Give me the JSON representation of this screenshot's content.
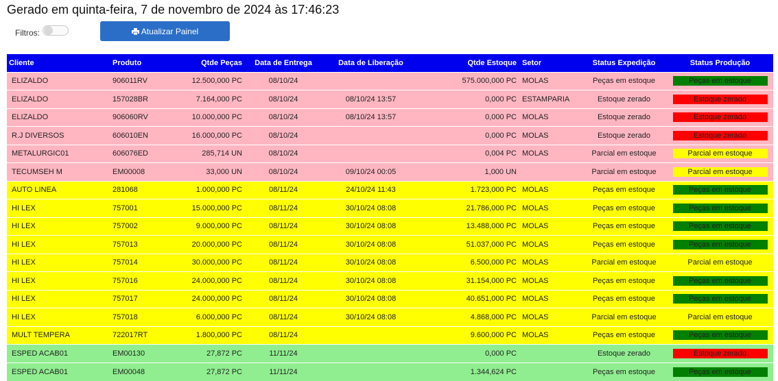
{
  "header": {
    "title": "Gerado em quinta-feira, 7 de novembro de 2024 às 17:46:23",
    "filters_label": "Filtros:",
    "refresh_label": "Atualizar Painel"
  },
  "table": {
    "columns": [
      "Cliente",
      "Produto",
      "Qtde Peças",
      "Data de Entrega",
      "Data de Liberação",
      "Qtde Estoque",
      "Setor",
      "Status Expedição",
      "Status Produção"
    ],
    "rows": [
      {
        "row_color": "#ffb6c1",
        "badge_color": "#008000",
        "cliente": "ELIZALDO",
        "produto": "906011RV",
        "qtde_pecas": "12.500,000 PC",
        "data_entrega": "08/10/24",
        "data_liberacao": "",
        "qtde_estoque": "575.000,000 PC",
        "setor": "MOLAS",
        "status_expedicao": "Peças em estoque",
        "status_producao": "Peças em estoque"
      },
      {
        "row_color": "#ffb6c1",
        "badge_color": "#ff0000",
        "cliente": "ELIZALDO",
        "produto": "157028BR",
        "qtde_pecas": "7.164,000 PC",
        "data_entrega": "08/10/24",
        "data_liberacao": "08/10/24 13:57",
        "qtde_estoque": "0,000 PC",
        "setor": "ESTAMPARIA",
        "status_expedicao": "Estoque zerado",
        "status_producao": "Estoque zerado"
      },
      {
        "row_color": "#ffb6c1",
        "badge_color": "#ff0000",
        "cliente": "ELIZALDO",
        "produto": "906060RV",
        "qtde_pecas": "10.000,000 PC",
        "data_entrega": "08/10/24",
        "data_liberacao": "08/10/24 13:57",
        "qtde_estoque": "0,000 PC",
        "setor": "MOLAS",
        "status_expedicao": "Estoque zerado",
        "status_producao": "Estoque zerado"
      },
      {
        "row_color": "#ffb6c1",
        "badge_color": "#ff0000",
        "cliente": "R.J DIVERSOS",
        "produto": "606010EN",
        "qtde_pecas": "16.000,000 PC",
        "data_entrega": "08/10/24",
        "data_liberacao": "",
        "qtde_estoque": "0,000 PC",
        "setor": "MOLAS",
        "status_expedicao": "Estoque zerado",
        "status_producao": "Estoque zerado"
      },
      {
        "row_color": "#ffb6c1",
        "badge_color": "#ffff00",
        "cliente": "METALURGIC01",
        "produto": "606076ED",
        "qtde_pecas": "285,714 UN",
        "data_entrega": "08/10/24",
        "data_liberacao": "",
        "qtde_estoque": "0,004 PC",
        "setor": "MOLAS",
        "status_expedicao": "Parcial em estoque",
        "status_producao": "Parcial em estoque"
      },
      {
        "row_color": "#ffb6c1",
        "badge_color": "#ffff00",
        "cliente": "TECUMSEH M",
        "produto": "EM00008",
        "qtde_pecas": "33,000 UN",
        "data_entrega": "08/10/24",
        "data_liberacao": "09/10/24 00:05",
        "qtde_estoque": "1,000 UN",
        "setor": "",
        "status_expedicao": "Parcial em estoque",
        "status_producao": "Parcial em estoque"
      },
      {
        "row_color": "#ffff00",
        "badge_color": "#008000",
        "cliente": "AUTO LINEA",
        "produto": "281068",
        "qtde_pecas": "1.000,000 PC",
        "data_entrega": "08/11/24",
        "data_liberacao": "24/10/24 11:43",
        "qtde_estoque": "1.723,000 PC",
        "setor": "MOLAS",
        "status_expedicao": "Peças em estoque",
        "status_producao": "Peças em estoque"
      },
      {
        "row_color": "#ffff00",
        "badge_color": "#008000",
        "cliente": "HI LEX",
        "produto": "757001",
        "qtde_pecas": "15.000,000 PC",
        "data_entrega": "08/11/24",
        "data_liberacao": "30/10/24 08:08",
        "qtde_estoque": "21.786,000 PC",
        "setor": "MOLAS",
        "status_expedicao": "Peças em estoque",
        "status_producao": "Peças em estoque"
      },
      {
        "row_color": "#ffff00",
        "badge_color": "#008000",
        "cliente": "HI LEX",
        "produto": "757002",
        "qtde_pecas": "9.000,000 PC",
        "data_entrega": "08/11/24",
        "data_liberacao": "30/10/24 08:08",
        "qtde_estoque": "13.488,000 PC",
        "setor": "MOLAS",
        "status_expedicao": "Peças em estoque",
        "status_producao": "Peças em estoque"
      },
      {
        "row_color": "#ffff00",
        "badge_color": "#008000",
        "cliente": "HI LEX",
        "produto": "757013",
        "qtde_pecas": "20.000,000 PC",
        "data_entrega": "08/11/24",
        "data_liberacao": "30/10/24 08:08",
        "qtde_estoque": "51.037,000 PC",
        "setor": "MOLAS",
        "status_expedicao": "Peças em estoque",
        "status_producao": "Peças em estoque"
      },
      {
        "row_color": "#ffff00",
        "badge_color": "#ffff00",
        "cliente": "HI LEX",
        "produto": "757014",
        "qtde_pecas": "30.000,000 PC",
        "data_entrega": "08/11/24",
        "data_liberacao": "30/10/24 08:08",
        "qtde_estoque": "6.500,000 PC",
        "setor": "MOLAS",
        "status_expedicao": "Parcial em estoque",
        "status_producao": "Parcial em estoque"
      },
      {
        "row_color": "#ffff00",
        "badge_color": "#008000",
        "cliente": "HI LEX",
        "produto": "757016",
        "qtde_pecas": "24.000,000 PC",
        "data_entrega": "08/11/24",
        "data_liberacao": "30/10/24 08:08",
        "qtde_estoque": "31.154,000 PC",
        "setor": "MOLAS",
        "status_expedicao": "Peças em estoque",
        "status_producao": "Peças em estoque"
      },
      {
        "row_color": "#ffff00",
        "badge_color": "#008000",
        "cliente": "HI LEX",
        "produto": "757017",
        "qtde_pecas": "24.000,000 PC",
        "data_entrega": "08/11/24",
        "data_liberacao": "30/10/24 08:08",
        "qtde_estoque": "40.651,000 PC",
        "setor": "MOLAS",
        "status_expedicao": "Peças em estoque",
        "status_producao": "Peças em estoque"
      },
      {
        "row_color": "#ffff00",
        "badge_color": "#ffff00",
        "cliente": "HI LEX",
        "produto": "757018",
        "qtde_pecas": "6.000,000 PC",
        "data_entrega": "08/11/24",
        "data_liberacao": "30/10/24 08:08",
        "qtde_estoque": "4.868,000 PC",
        "setor": "MOLAS",
        "status_expedicao": "Parcial em estoque",
        "status_producao": "Parcial em estoque"
      },
      {
        "row_color": "#ffff00",
        "badge_color": "#008000",
        "cliente": "MULT TEMPERA",
        "produto": "722017RT",
        "qtde_pecas": "1.800,000 PC",
        "data_entrega": "08/11/24",
        "data_liberacao": "",
        "qtde_estoque": "9.600,000 PC",
        "setor": "MOLAS",
        "status_expedicao": "Peças em estoque",
        "status_producao": "Peças em estoque"
      },
      {
        "row_color": "#90ee90",
        "badge_color": "#ff0000",
        "cliente": "ESPED ACAB01",
        "produto": "EM00130",
        "qtde_pecas": "27,872 PC",
        "data_entrega": "11/11/24",
        "data_liberacao": "",
        "qtde_estoque": "0,000 PC",
        "setor": "",
        "status_expedicao": "Estoque zerado",
        "status_producao": "Estoque zerado"
      },
      {
        "row_color": "#90ee90",
        "badge_color": "#008000",
        "cliente": "ESPED ACAB01",
        "produto": "EM00048",
        "qtde_pecas": "27,872 PC",
        "data_entrega": "11/11/24",
        "data_liberacao": "",
        "qtde_estoque": "1.344,624 PC",
        "setor": "",
        "status_expedicao": "Peças em estoque",
        "status_producao": "Peças em estoque"
      }
    ]
  }
}
